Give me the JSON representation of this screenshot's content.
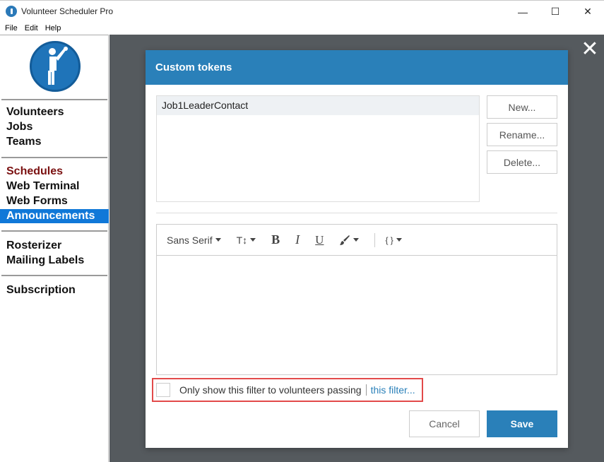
{
  "window": {
    "title": "Volunteer Scheduler Pro",
    "controls": {
      "minimize": "—",
      "maximize": "☐",
      "close": "✕"
    }
  },
  "menu": {
    "items": [
      "File",
      "Edit",
      "Help"
    ]
  },
  "sidebar": {
    "group1": [
      "Volunteers",
      "Jobs",
      "Teams"
    ],
    "group2": [
      "Schedules",
      "Web Terminal",
      "Web Forms",
      "Announcements"
    ],
    "group3": [
      "Rosterizer",
      "Mailing Labels"
    ],
    "group4": [
      "Subscription"
    ],
    "active": "Announcements"
  },
  "backdrop": {
    "close_glyph": "✕"
  },
  "modal": {
    "title": "Custom tokens",
    "tokens": [
      "Job1LeaderContact"
    ],
    "buttons": {
      "new": "New...",
      "rename": "Rename...",
      "delete": "Delete..."
    },
    "toolbar": {
      "font": "Sans Serif",
      "size_glyph": "T↕",
      "bold": "B",
      "italic": "I",
      "underline": "U",
      "code_glyph": "{ }"
    },
    "filter": {
      "label": "Only show this filter to volunteers passing",
      "link": "this filter..."
    },
    "cancel": "Cancel",
    "save": "Save"
  },
  "colors": {
    "accent": "#2a80b9",
    "active_nav": "#1078d8",
    "schedules_text": "#7a1010",
    "highlight_border": "#e24a4a"
  }
}
